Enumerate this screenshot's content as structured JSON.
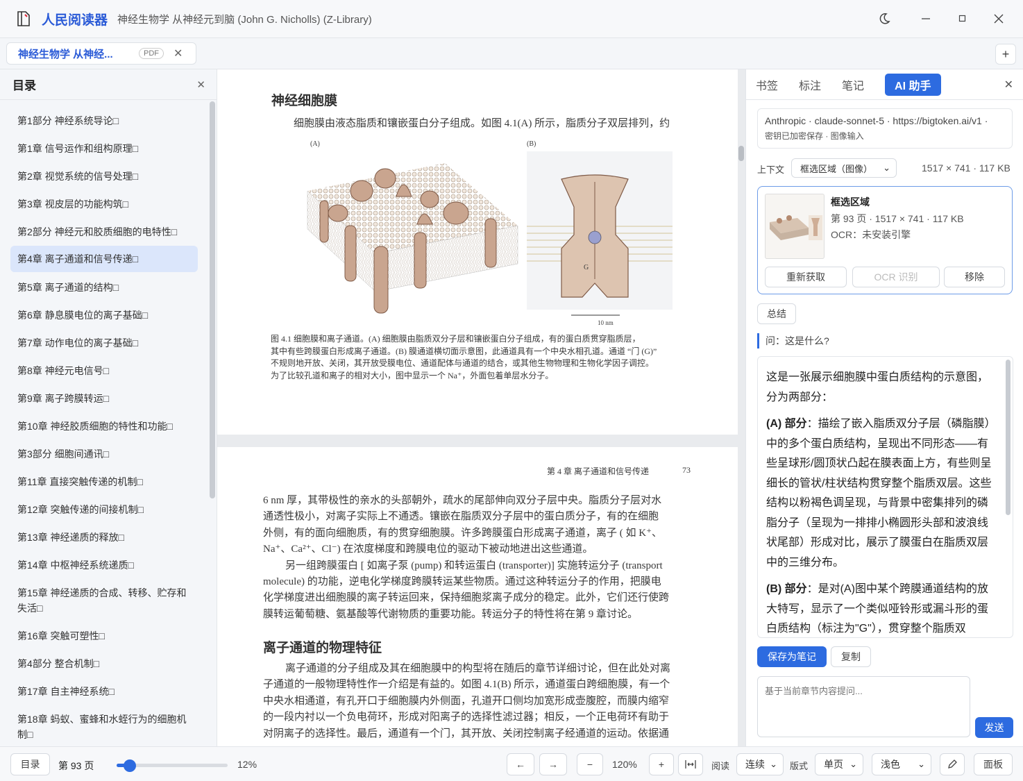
{
  "app": {
    "name": "人民阅读器",
    "document_title": "神经生物学 从神经元到脑 (John G. Nicholls) (Z-Library)"
  },
  "tabs": [
    {
      "label": "神经生物学 从神经...",
      "badge": "PDF"
    }
  ],
  "toc": {
    "title": "目录",
    "items": [
      {
        "label": "第1部分 神经系统导论□"
      },
      {
        "label": "第1章 信号运作和组构原理□"
      },
      {
        "label": "第2章 视觉系统的信号处理□"
      },
      {
        "label": "第3章 视皮层的功能构筑□"
      },
      {
        "label": "第2部分 神经元和胶质细胞的电特性□"
      },
      {
        "label": "第4章 离子通道和信号传递□",
        "active": true
      },
      {
        "label": "第5章 离子通道的结构□"
      },
      {
        "label": "第6章 静息膜电位的离子基础□"
      },
      {
        "label": "第7章 动作电位的离子基础□"
      },
      {
        "label": "第8章 神经元电信号□"
      },
      {
        "label": "第9章 离子跨膜转运□"
      },
      {
        "label": "第10章 神经胶质细胞的特性和功能□"
      },
      {
        "label": "第3部分 细胞间通讯□"
      },
      {
        "label": "第11章 直接突触传递的机制□"
      },
      {
        "label": "第12章 突触传递的间接机制□"
      },
      {
        "label": "第13章 神经递质的释放□"
      },
      {
        "label": "第14章 中枢神经系统递质□"
      },
      {
        "label": "第15章 神经递质的合成、转移、贮存和失活□"
      },
      {
        "label": "第16章 突触可塑性□"
      },
      {
        "label": "第4部分 整合机制□"
      },
      {
        "label": "第17章 自主神经系统□"
      },
      {
        "label": "第18章 蚂蚁、蜜蜂和水蛭行为的细胞机制□"
      }
    ]
  },
  "page1": {
    "heading": "神经细胞膜",
    "para": "细胞膜由液态脂质和镶嵌蛋白分子组成。如图 4.1(A) 所示，脂质分子双层排列，约",
    "fig_label_a": "(A)",
    "fig_label_b": "(B)",
    "fig_g": "G",
    "scale": "10 nm",
    "caption_lines": [
      "图 4.1   细胞膜和离子通道。(A) 细胞膜由脂质双分子层和镶嵌蛋白分子组成，有的蛋白质贯穿脂质层，",
      "其中有些跨膜蛋白形成离子通道。(B) 膜通道横切面示意图，此通道具有一个中央水相孔道。通道 “门 (G)”",
      "不规则地开放、关闭，其开放受膜电位、通道配体与通道的结合，或其他生物物理和生物化学因子调控。",
      "为了比较孔道和离子的相对大小，图中显示一个 Na⁺，外面包着单层水分子。"
    ]
  },
  "page2": {
    "running_head": "第 4 章   离子通道和信号传递",
    "page_number": "73",
    "paragraphs": [
      "6 nm 厚，其带极性的亲水的头部朝外，疏水的尾部伸向双分子层中央。脂质分子层对水",
      "通透性极小，对离子实际上不通透。镶嵌在脂质双分子层中的蛋白质分子，有的在细胞",
      "外侧，有的面向细胞质，有的贯穿细胞膜。许多跨膜蛋白形成离子通道，离子 ( 如 K⁺、",
      "Na⁺、Ca²⁺、Cl⁻) 在浓度梯度和跨膜电位的驱动下被动地进出这些通道。",
      "另一组跨膜蛋白 [ 如离子泵 (pump) 和转运蛋白 (transporter)] 实施转运分子 (transport",
      "molecule) 的功能，逆电化学梯度跨膜转运某些物质。通过这种转运分子的作用，把膜电",
      "化学梯度进出细胞膜的离子转运回来，保持细胞浆离子成分的稳定。此外，它们还行使跨",
      "膜转运葡萄糖、氨基酸等代谢物质的重要功能。转运分子的特性将在第 9 章讨论。"
    ],
    "heading2": "离子通道的物理特征",
    "paragraphs2": [
      "离子通道的分子组成及其在细胞膜中的构型将在随后的章节详细讨论，但在此处对离",
      "子通道的一般物理特性作一介绍是有益的。如图 4.1(B) 所示，通道蛋白跨细胞膜，有一个",
      "中央水相通道，有孔开口于细胞膜内外侧面，孔道开口侧均加宽形成壶腹腔，而膜内缩窄",
      "的一段内衬以一个负电荷环，形成对阳离子的选择性滤过器；相反，一个正电荷环有助于",
      "对阴离子的选择性。最后，通道有一个门，其开放、关闭控制离子经通道的运动。依据通"
    ]
  },
  "side": {
    "tabs": [
      "书签",
      "标注",
      "笔记",
      "AI 助手"
    ],
    "active_tab": "AI 助手",
    "model_info": "Anthropic · claude-sonnet-5 · https://bigtoken.ai/v1 ·",
    "model_sub": "密钥已加密保存 · 图像输入",
    "context_label": "上下文",
    "context_value": "框选区域（图像）",
    "context_meta": "1517 × 741 · 117 KB",
    "selection": {
      "title": "框选区域",
      "meta": "第 93 页 · 1517 × 741 · 117 KB",
      "ocr": "OCR：未安装引擎",
      "btn_refetch": "重新获取",
      "btn_ocr": "OCR 识别",
      "btn_remove": "移除"
    },
    "summary_btn": "总结",
    "question": "问：这是什么?",
    "answer": {
      "intro": "这是一张展示细胞膜中蛋白质结构的示意图，分为两部分：",
      "a_label": "(A) 部分",
      "a_text": "：描绘了嵌入脂质双分子层（磷脂膜）中的多个蛋白质结构，呈现出不同形态——有些呈球形/圆顶状凸起在膜表面上方，有些则呈细长的管状/柱状结构贯穿整个脂质双层。这些结构以粉褐色调呈现，与背景中密集排列的磷脂分子（呈现为一排排小椭圆形头部和波浪线状尾部）形成对比，展示了膜蛋白在脂质双层中的三维分布。",
      "b_label": "(B) 部分",
      "b_text": "：是对(A)图中某个跨膜通道结构的放大特写，显示了一个类似哑铃形或漏斗形的蛋白质结构（标注为\"G\"），贯穿整个脂质双"
    },
    "save_note_btn": "保存为笔记",
    "copy_btn": "复制",
    "input_placeholder": "基于当前章节内容提问...",
    "send_btn": "发送"
  },
  "bottom": {
    "toc_btn": "目录",
    "page_label": "第 93 页",
    "progress_percent": 12,
    "progress_text": "12%",
    "prev": "←",
    "next": "→",
    "zoom_out": "−",
    "zoom_level": "120%",
    "zoom_in": "+",
    "read_label": "阅读",
    "read_mode": "连续",
    "layout_label": "版式",
    "layout_mode": "单页",
    "theme": "浅色",
    "panel_btn": "面板"
  },
  "colors": {
    "accent": "#2d6be0",
    "brand": "#2b5bd7",
    "active_toc_bg": "#dbe6fb"
  }
}
